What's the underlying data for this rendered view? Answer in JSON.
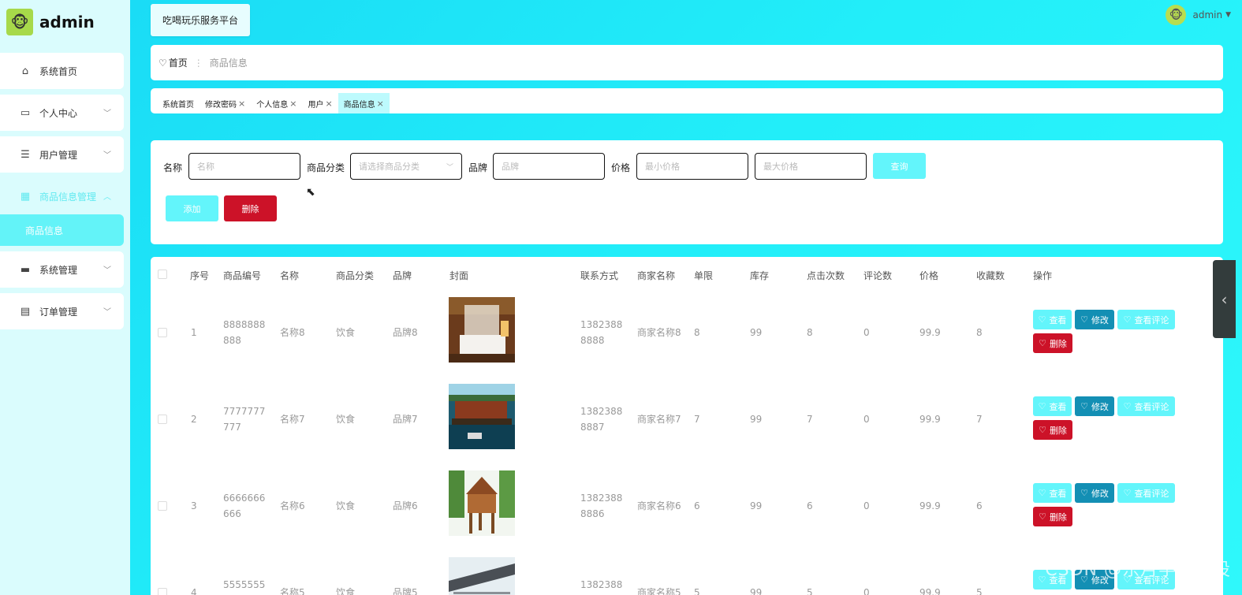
{
  "brand": {
    "name": "admin",
    "logo_icon": "mascot-avatar"
  },
  "sidebar": {
    "items": [
      {
        "label": "系统首页",
        "icon": "home-icon"
      },
      {
        "label": "个人中心",
        "icon": "card-icon"
      },
      {
        "label": "用户管理",
        "icon": "list-icon"
      },
      {
        "label": "商品信息管理",
        "icon": "grid-icon"
      },
      {
        "label": "系统管理",
        "icon": "monitor-icon"
      },
      {
        "label": "订单管理",
        "icon": "clipboard-icon"
      }
    ],
    "submenu": {
      "label": "商品信息"
    }
  },
  "topbar": {
    "platform": "吃喝玩乐服务平台",
    "user": "admin"
  },
  "breadcrumb": {
    "home": "首页",
    "sep": "⋮",
    "current": "商品信息"
  },
  "tabs": [
    {
      "label": "系统首页"
    },
    {
      "label": "修改密码"
    },
    {
      "label": "个人信息"
    },
    {
      "label": "用户"
    },
    {
      "label": "商品信息"
    }
  ],
  "search": {
    "name_label": "名称",
    "name_placeholder": "名称",
    "category_label": "商品分类",
    "category_placeholder": "请选择商品分类",
    "brand_label": "品牌",
    "brand_placeholder": "品牌",
    "price_label": "价格",
    "min_placeholder": "最小价格",
    "max_placeholder": "最大价格",
    "query_btn": "查询",
    "add_btn": "添加",
    "delete_btn": "删除"
  },
  "table": {
    "headers": [
      "序号",
      "商品编号",
      "名称",
      "商品分类",
      "品牌",
      "封面",
      "联系方式",
      "商家名称",
      "单限",
      "库存",
      "点击次数",
      "评论数",
      "价格",
      "收藏数",
      "操作"
    ],
    "actions": {
      "view": "查看",
      "edit": "修改",
      "comments": "查看评论",
      "delete": "删除"
    },
    "rows": [
      {
        "idx": "1",
        "code1": "8888888",
        "code2": "888",
        "name": "名称8",
        "category": "饮食",
        "brand": "品牌8",
        "phone1": "1382388",
        "phone2": "8888",
        "shop": "商家名称8",
        "limit": "8",
        "stock": "99",
        "clicks": "8",
        "comments": "0",
        "price": "99.9",
        "favs": "8"
      },
      {
        "idx": "2",
        "code1": "7777777",
        "code2": "777",
        "name": "名称7",
        "category": "饮食",
        "brand": "品牌7",
        "phone1": "1382388",
        "phone2": "8887",
        "shop": "商家名称7",
        "limit": "7",
        "stock": "99",
        "clicks": "7",
        "comments": "0",
        "price": "99.9",
        "favs": "7"
      },
      {
        "idx": "3",
        "code1": "6666666",
        "code2": "666",
        "name": "名称6",
        "category": "饮食",
        "brand": "品牌6",
        "phone1": "1382388",
        "phone2": "8886",
        "shop": "商家名称6",
        "limit": "6",
        "stock": "99",
        "clicks": "6",
        "comments": "0",
        "price": "99.9",
        "favs": "6"
      },
      {
        "idx": "4",
        "code1": "5555555",
        "code2": "",
        "name": "名称5",
        "category": "饮食",
        "brand": "品牌5",
        "phone1": "1382388",
        "phone2": "",
        "shop": "商家名称5",
        "limit": "5",
        "stock": "99",
        "clicks": "5",
        "comments": "0",
        "price": "99.9",
        "favs": "5"
      }
    ]
  },
  "watermark": "CSDN @东月学姐毕设"
}
